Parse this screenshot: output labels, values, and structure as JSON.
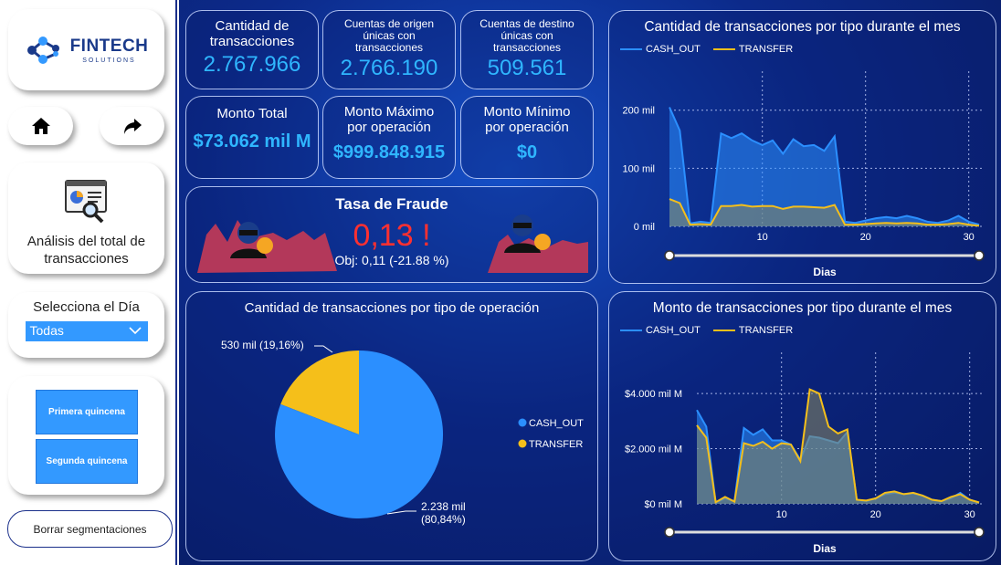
{
  "sidebar": {
    "logo_name": "FINTECH",
    "logo_sub": "SOLUTIONS",
    "analysis_label": "Análisis del total de transacciones",
    "day_label": "Selecciona el Día",
    "day_value": "Todas",
    "q1_label": "Primera quincena",
    "q2_label": "Segunda quincena",
    "clear_label": "Borrar segmentaciones",
    "icons": [
      "home-icon",
      "share-arrow-icon",
      "analysis-report-icon",
      "chevron-down-icon"
    ]
  },
  "kpis": {
    "cantidad": {
      "title": "Cantidad de transacciones",
      "value": "2.767.966"
    },
    "origen": {
      "title": "Cuentas de origen únicas con transacciones",
      "value": "2.766.190"
    },
    "destino": {
      "title": "Cuentas de destino únicas con transacciones",
      "value": "509.561"
    },
    "monto_total": {
      "title": "Monto Total",
      "value": "$73.062 mil M"
    },
    "monto_max": {
      "title": "Monto Máximo por operación",
      "value": "$999.848.915"
    },
    "monto_min": {
      "title": "Monto Mínimo por operación",
      "value": "$0"
    }
  },
  "fraude": {
    "title": "Tasa de Fraude",
    "value": "0,13 !",
    "target": "Obj: 0,11 (-21.88 %)",
    "colors": {
      "value": "#ff3030",
      "mountains": "#b3385a"
    }
  },
  "colors": {
    "cash_out": "#2b8fff",
    "transfer": "#f5bf1a",
    "accent": "#2fb6ff"
  },
  "chart_data": [
    {
      "type": "area",
      "title": "Cantidad de transacciones por tipo durante el mes",
      "xlabel": "Dias",
      "ylabel": "",
      "x_ticks": [
        10,
        20,
        30
      ],
      "y_ticks": [
        "0 mil",
        "100 mil",
        "200 mil"
      ],
      "ylim": [
        0,
        220000
      ],
      "xlim": [
        1,
        31
      ],
      "grid": true,
      "legend_position": "top-left",
      "x": [
        1,
        2,
        3,
        4,
        5,
        6,
        7,
        8,
        9,
        10,
        11,
        12,
        13,
        14,
        15,
        16,
        17,
        18,
        19,
        20,
        21,
        22,
        23,
        24,
        25,
        26,
        27,
        28,
        29,
        30,
        31
      ],
      "series": [
        {
          "name": "CASH_OUT",
          "color": "#2b8fff",
          "values": [
            205000,
            165000,
            5000,
            8000,
            6000,
            160000,
            152000,
            160000,
            148000,
            140000,
            148000,
            125000,
            150000,
            138000,
            140000,
            130000,
            155000,
            8000,
            6000,
            10000,
            14000,
            16000,
            14000,
            18000,
            14000,
            8000,
            6000,
            10000,
            18000,
            8000,
            3000
          ]
        },
        {
          "name": "TRANSFER",
          "color": "#f5bf1a",
          "values": [
            47000,
            40000,
            3000,
            4000,
            3000,
            35000,
            35000,
            37000,
            34000,
            35000,
            35000,
            30000,
            34000,
            34000,
            33000,
            32000,
            37000,
            3000,
            3000,
            4000,
            5000,
            6000,
            5000,
            6000,
            5000,
            3000,
            3000,
            4000,
            6000,
            3000,
            1000
          ]
        }
      ]
    },
    {
      "type": "pie",
      "title": "Cantidad de transacciones por tipo de operación",
      "categories": [
        "CASH_OUT",
        "TRANSFER"
      ],
      "values": [
        2238000,
        530000
      ],
      "percent": [
        80.84,
        19.16
      ],
      "labels": [
        "2.238 mil (80,84%)",
        "530 mil (19,16%)"
      ],
      "colors": [
        "#2b8fff",
        "#f5bf1a"
      ],
      "legend_position": "right"
    },
    {
      "type": "area",
      "title": "Monto de transacciones por tipo durante el mes",
      "xlabel": "Dias",
      "ylabel": "",
      "x_ticks": [
        10,
        20,
        30
      ],
      "y_ticks": [
        "$0 mil M",
        "$2.000 mil M",
        "$4.000 mil M"
      ],
      "ylim": [
        0,
        4500
      ],
      "xlim": [
        1,
        31
      ],
      "grid": true,
      "legend_position": "top-left",
      "x": [
        1,
        2,
        3,
        4,
        5,
        6,
        7,
        8,
        9,
        10,
        11,
        12,
        13,
        14,
        15,
        16,
        17,
        18,
        19,
        20,
        21,
        22,
        23,
        24,
        25,
        26,
        27,
        28,
        29,
        30,
        31
      ],
      "series": [
        {
          "name": "CASH_OUT",
          "color": "#2b8fff",
          "values": [
            3400,
            2800,
            50,
            200,
            100,
            2750,
            2500,
            2700,
            2300,
            2300,
            2150,
            1600,
            2450,
            2400,
            2300,
            2200,
            2600,
            150,
            100,
            200,
            350,
            400,
            350,
            380,
            300,
            150,
            100,
            200,
            400,
            150,
            50
          ]
        },
        {
          "name": "TRANSFER",
          "color": "#f5bf1a",
          "values": [
            2850,
            2400,
            60,
            250,
            80,
            2200,
            2100,
            2250,
            2000,
            2200,
            2150,
            1550,
            4150,
            4000,
            2800,
            2550,
            2700,
            150,
            120,
            200,
            400,
            450,
            350,
            400,
            300,
            150,
            100,
            250,
            350,
            150,
            50
          ]
        }
      ]
    }
  ]
}
